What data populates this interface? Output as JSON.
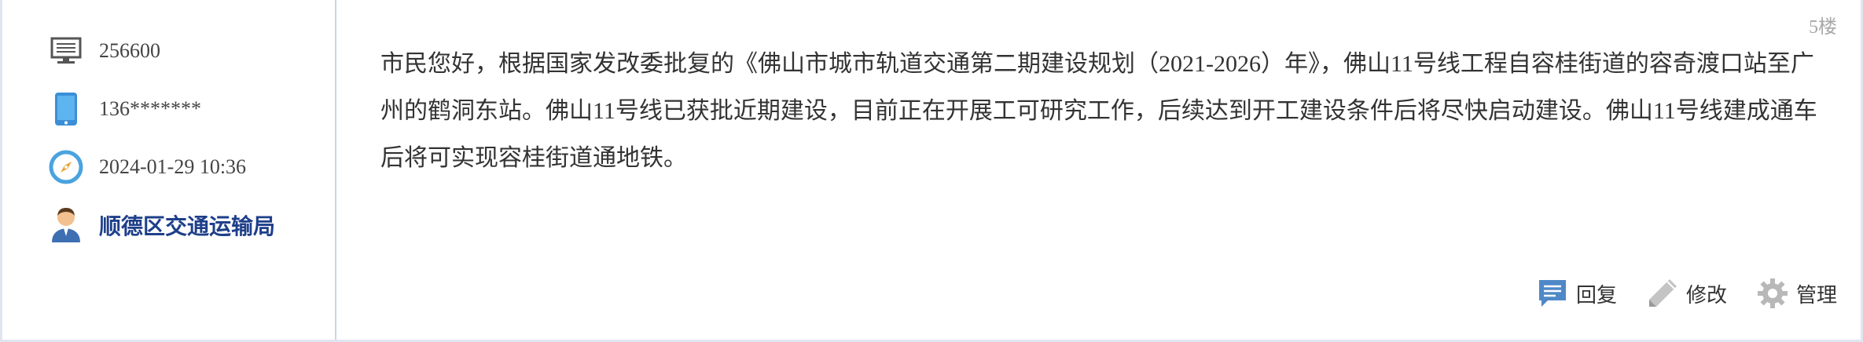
{
  "post": {
    "floor_label": "5楼",
    "content": "市民您好，根据国家发改委批复的《佛山市城市轨道交通第二期建设规划（2021-2026）年》，佛山11号线工程自容桂街道的容奇渡口站至广州的鹤洞东站。佛山11号线已获批近期建设，目前正在开展工可研究工作，后续达到开工建设条件后将尽快启动建设。佛山11号线建成通车后将可实现容桂街道通地铁。"
  },
  "sidebar": {
    "items": [
      {
        "icon": "computer-icon",
        "text": "256600"
      },
      {
        "icon": "phone-icon",
        "text": "136*******"
      },
      {
        "icon": "compass-clock-icon",
        "text": "2024-01-29 10:36"
      },
      {
        "icon": "user-icon",
        "text": "顺德区交通运输局"
      }
    ]
  },
  "actions": {
    "reply_label": "回复",
    "edit_label": "修改",
    "manage_label": "管理"
  },
  "colors": {
    "border": "#c5d6ea",
    "dept_text": "#1e3f8a",
    "reply_icon": "#4f88c7",
    "compass_ring": "#4aa3df"
  }
}
